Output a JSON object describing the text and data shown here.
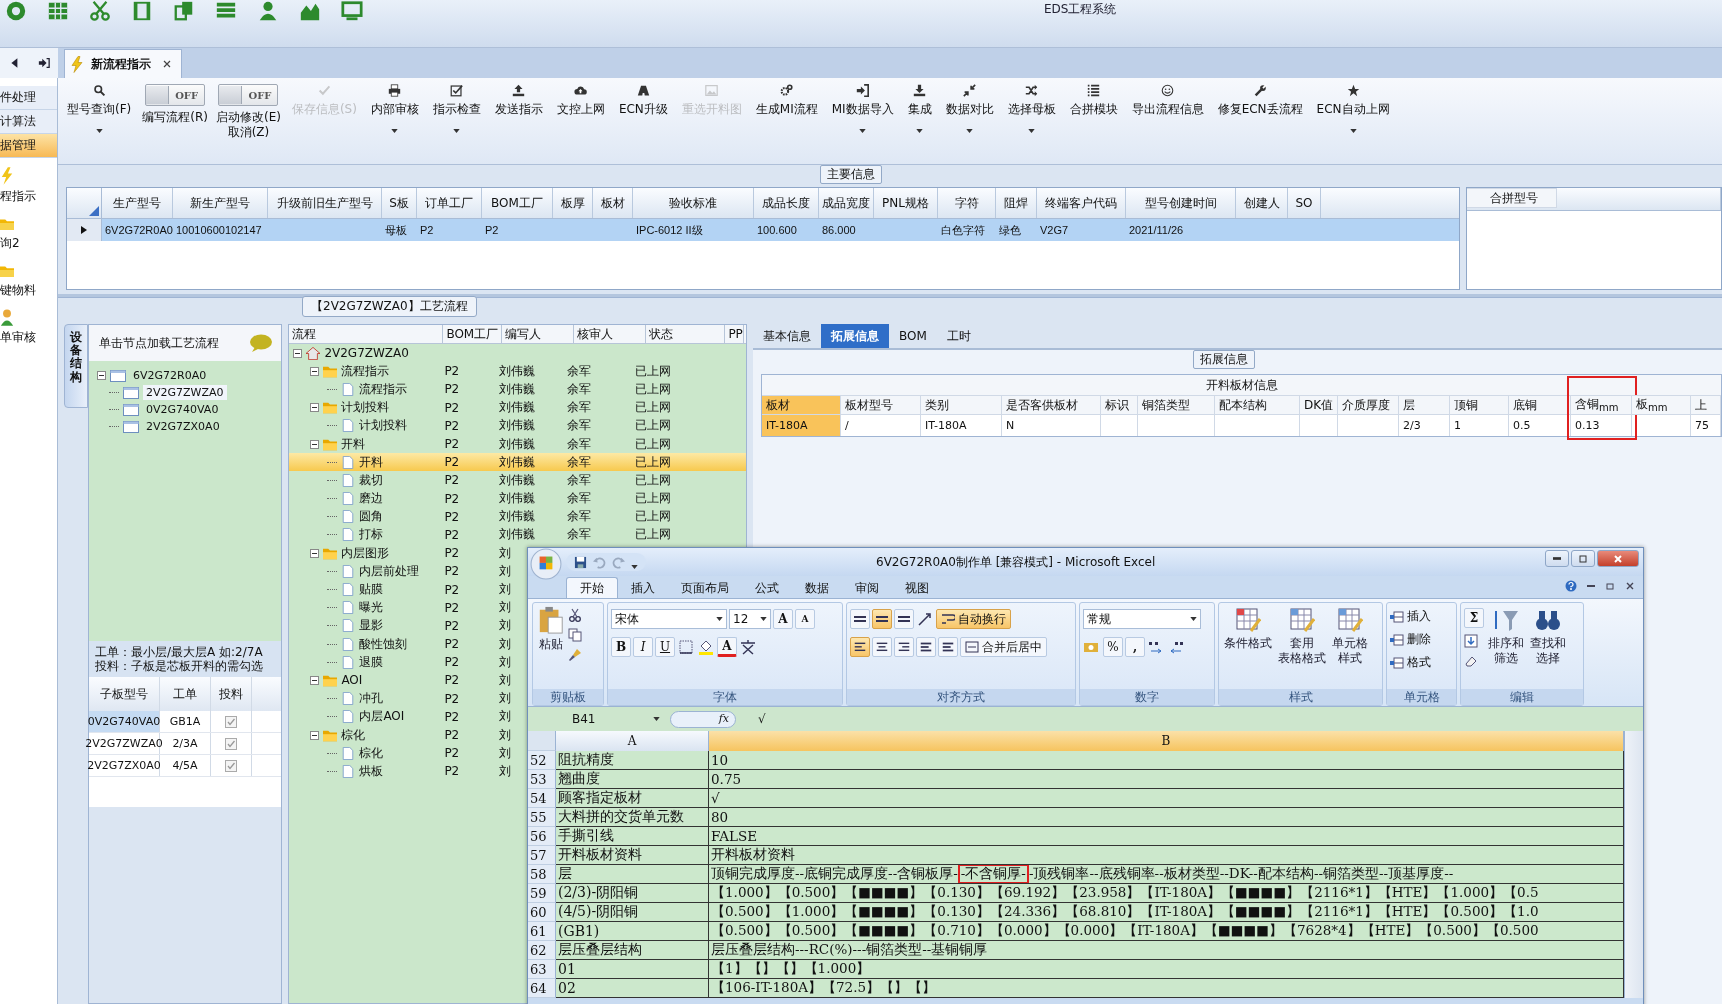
{
  "app_title": "EDS工程系统",
  "nav_items": [
    {
      "label": "件处理",
      "kind": "text",
      "selected": false
    },
    {
      "label": "计算法",
      "kind": "text",
      "selected": false
    },
    {
      "label": "据管理",
      "kind": "text",
      "selected": true
    },
    {
      "label": "程指示",
      "kind": "bolt",
      "selected": false
    },
    {
      "label": "询2",
      "kind": "folder",
      "selected": false
    },
    {
      "label": "键物料",
      "kind": "folder",
      "selected": false
    },
    {
      "label": "单审核",
      "kind": "person",
      "selected": false
    }
  ],
  "tabs": [
    {
      "label": "新流程指示",
      "selected": true
    }
  ],
  "toolbar": [
    {
      "kind": "search",
      "lines": [
        "型号查询(F)"
      ],
      "dropdown": true,
      "disabled": false
    },
    {
      "kind": "toggle",
      "toggle_text": "OFF",
      "on": false,
      "lines": [
        "编写流程(R)"
      ],
      "disabled": false
    },
    {
      "kind": "toggle",
      "toggle_text": "OFF",
      "on": false,
      "lines": [
        "启动修改(E)",
        "取消(Z)"
      ],
      "disabled": false
    },
    {
      "kind": "check",
      "lines": [
        "保存信息(S)"
      ],
      "dropdown": false,
      "disabled": true
    },
    {
      "kind": "print",
      "lines": [
        "内部审核"
      ],
      "dropdown": true,
      "disabled": false
    },
    {
      "kind": "checkbox",
      "lines": [
        "指示检查"
      ],
      "dropdown": true,
      "disabled": false
    },
    {
      "kind": "upload",
      "lines": [
        "发送指示"
      ],
      "dropdown": false,
      "disabled": false
    },
    {
      "kind": "cloud",
      "lines": [
        "文控上网"
      ],
      "dropdown": false,
      "disabled": false
    },
    {
      "kind": "road",
      "lines": [
        "ECN升级"
      ],
      "dropdown": false,
      "disabled": false
    },
    {
      "kind": "picture",
      "lines": [
        "重选开料图"
      ],
      "dropdown": false,
      "disabled": true
    },
    {
      "kind": "gears",
      "lines": [
        "生成MI流程"
      ],
      "dropdown": false,
      "disabled": false
    },
    {
      "kind": "import",
      "lines": [
        "MI数据导入"
      ],
      "dropdown": true,
      "disabled": false
    },
    {
      "kind": "download",
      "lines": [
        "集成"
      ],
      "dropdown": true,
      "disabled": false
    },
    {
      "kind": "compress",
      "lines": [
        "数据对比"
      ],
      "dropdown": true,
      "disabled": false
    },
    {
      "kind": "shuffle",
      "lines": [
        "选择母板"
      ],
      "dropdown": true,
      "disabled": false
    },
    {
      "kind": "list",
      "lines": [
        "合拼模块"
      ],
      "dropdown": false,
      "disabled": false
    },
    {
      "kind": "smile",
      "lines": [
        "导出流程信息"
      ],
      "dropdown": false,
      "disabled": false
    },
    {
      "kind": "wrench",
      "lines": [
        "修复ECN丢流程"
      ],
      "dropdown": false,
      "disabled": false
    },
    {
      "kind": "star",
      "lines": [
        "ECN自动上网"
      ],
      "dropdown": true,
      "disabled": false
    }
  ],
  "main_info": {
    "title": "主要信息",
    "columns": [
      "生产型号",
      "新生产型号",
      "升级前旧生产型号",
      "S板",
      "订单工厂",
      "BOM工厂",
      "板厚",
      "板材",
      "验收标准",
      "成品长度",
      "成品宽度",
      "PNL规格",
      "字符",
      "阻焊",
      "终端客户代码",
      "型号创建时间",
      "创建人",
      "SO"
    ],
    "rows": [
      {
        "selected": true,
        "cells": [
          "6V2G72R0A0",
          "10010600102147",
          "",
          "母板",
          "P2",
          "P2",
          "",
          "",
          "IPC-6012 II级",
          "100.600",
          "86.000",
          "",
          "白色字符",
          "绿色",
          "V2G7",
          "2021/11/26",
          "",
          ""
        ]
      }
    ],
    "merge_columns": [
      "合拼型号"
    ]
  },
  "process_flow": {
    "title": "【2V2G7ZWZA0】工艺流程",
    "side_tab": "设备结构",
    "device_header": "单击节点加载工艺流程",
    "device_tree": [
      {
        "name": "6V2G72R0A0",
        "expanded": true,
        "selected": false,
        "children": [
          {
            "name": "2V2G7ZWZA0",
            "selected": true
          },
          {
            "name": "0V2G740VA0",
            "selected": false
          },
          {
            "name": "2V2G7ZX0A0",
            "selected": false
          }
        ]
      }
    ],
    "note": [
      "工单：最小层/最大层A 如:2/7A",
      "投料：子板是芯板开料的需勾选"
    ],
    "sub_columns": [
      "子板型号",
      "工单",
      "投料"
    ],
    "sub_rows": [
      {
        "model": "0V2G740VA0",
        "order": "GB1A",
        "checked": true,
        "selected": true
      },
      {
        "model": "2V2G7ZWZA0",
        "order": "2/3A",
        "checked": true,
        "selected": false
      },
      {
        "model": "2V2G7ZX0A0",
        "order": "4/5A",
        "checked": true,
        "selected": false
      }
    ],
    "columns": [
      "流程",
      "BOM工厂",
      "编写人",
      "核审人",
      "状态",
      "PP"
    ],
    "tree": [
      {
        "name": "2V2G7ZWZA0",
        "kind": "root",
        "expanded": true,
        "selected": false,
        "children": [
          {
            "name": "流程指示",
            "kind": "folder",
            "expanded": true,
            "selected": false,
            "bom": "P2",
            "writer": "刘伟巍",
            "reviewer": "余军",
            "status": "已上网",
            "children": [
              {
                "name": "流程指示",
                "kind": "file",
                "selected": false,
                "bom": "P2",
                "writer": "刘伟巍",
                "reviewer": "余军",
                "status": "已上网"
              }
            ]
          },
          {
            "name": "计划投料",
            "kind": "folder",
            "expanded": true,
            "selected": false,
            "bom": "P2",
            "writer": "刘伟巍",
            "reviewer": "余军",
            "status": "已上网",
            "children": [
              {
                "name": "计划投料",
                "kind": "file",
                "selected": false,
                "bom": "P2",
                "writer": "刘伟巍",
                "reviewer": "余军",
                "status": "已上网"
              }
            ]
          },
          {
            "name": "开料",
            "kind": "folder",
            "expanded": true,
            "selected": false,
            "bom": "P2",
            "writer": "刘伟巍",
            "reviewer": "余军",
            "status": "已上网",
            "children": [
              {
                "name": "开料",
                "kind": "file",
                "selected": true,
                "bom": "P2",
                "writer": "刘伟巍",
                "reviewer": "余军",
                "status": "已上网"
              },
              {
                "name": "裁切",
                "kind": "file",
                "selected": false,
                "bom": "P2",
                "writer": "刘伟巍",
                "reviewer": "余军",
                "status": "已上网"
              },
              {
                "name": "磨边",
                "kind": "file",
                "selected": false,
                "bom": "P2",
                "writer": "刘伟巍",
                "reviewer": "余军",
                "status": "已上网"
              },
              {
                "name": "圆角",
                "kind": "file",
                "selected": false,
                "bom": "P2",
                "writer": "刘伟巍",
                "reviewer": "余军",
                "status": "已上网"
              },
              {
                "name": "打标",
                "kind": "file",
                "selected": false,
                "bom": "P2",
                "writer": "刘伟巍",
                "reviewer": "余军",
                "status": "已上网"
              }
            ]
          },
          {
            "name": "内层图形",
            "kind": "folder",
            "expanded": true,
            "selected": false,
            "bom": "P2",
            "writer": "刘",
            "children": [
              {
                "name": "内层前处理",
                "kind": "file",
                "selected": false,
                "bom": "P2",
                "writer": "刘"
              },
              {
                "name": "贴膜",
                "kind": "file",
                "selected": false,
                "bom": "P2",
                "writer": "刘"
              },
              {
                "name": "曝光",
                "kind": "file",
                "selected": false,
                "bom": "P2",
                "writer": "刘"
              },
              {
                "name": "显影",
                "kind": "file",
                "selected": false,
                "bom": "P2",
                "writer": "刘"
              },
              {
                "name": "酸性蚀刻",
                "kind": "file",
                "selected": false,
                "bom": "P2",
                "writer": "刘"
              },
              {
                "name": "退膜",
                "kind": "file",
                "selected": false,
                "bom": "P2",
                "writer": "刘"
              }
            ]
          },
          {
            "name": "AOI",
            "kind": "folder",
            "expanded": true,
            "selected": false,
            "bom": "P2",
            "writer": "刘",
            "children": [
              {
                "name": "冲孔",
                "kind": "file",
                "selected": false,
                "bom": "P2",
                "writer": "刘"
              },
              {
                "name": "内层AOI",
                "kind": "file",
                "selected": false,
                "bom": "P2",
                "writer": "刘"
              }
            ]
          },
          {
            "name": "棕化",
            "kind": "folder",
            "expanded": true,
            "selected": false,
            "bom": "P2",
            "writer": "刘",
            "children": [
              {
                "name": "棕化",
                "kind": "file",
                "selected": false,
                "bom": "P2",
                "writer": "刘"
              },
              {
                "name": "烘板",
                "kind": "file",
                "selected": false,
                "bom": "P2",
                "writer": "刘"
              }
            ]
          }
        ]
      }
    ]
  },
  "detail_tabs": [
    {
      "label": "基本信息",
      "selected": false
    },
    {
      "label": "拓展信息",
      "selected": true
    },
    {
      "label": "BOM",
      "selected": false
    },
    {
      "label": "工时",
      "selected": false
    }
  ],
  "detail_group": "拓展信息",
  "material_table": {
    "title": "开料板材信息",
    "columns": [
      {
        "label": "板材",
        "selected": true,
        "boxed": false
      },
      {
        "label": "板材型号",
        "selected": false,
        "boxed": false
      },
      {
        "label": "类别",
        "selected": false,
        "boxed": false
      },
      {
        "label": "是否客供板材",
        "selected": false,
        "boxed": false
      },
      {
        "label": "标识",
        "selected": false,
        "boxed": false
      },
      {
        "label": "铜箔类型",
        "selected": false,
        "boxed": false
      },
      {
        "label": "配本结构",
        "selected": false,
        "boxed": false
      },
      {
        "label": "DK值",
        "selected": false,
        "boxed": false
      },
      {
        "label": "介质厚度",
        "selected": false,
        "boxed": false
      },
      {
        "label": "层",
        "selected": false,
        "boxed": false
      },
      {
        "label": "顶铜",
        "selected": false,
        "boxed": false
      },
      {
        "label": "底铜",
        "selected": false,
        "boxed": false
      },
      {
        "label": "含铜$_{mm}$",
        "selected": false,
        "boxed": true
      },
      {
        "label": "板$_{mm}$",
        "selected": false,
        "boxed": false
      },
      {
        "label": "上",
        "selected": false,
        "boxed": false
      }
    ],
    "rows": [
      [
        "IT-180A",
        "/",
        "IT-180A",
        "N",
        "",
        "",
        "",
        "",
        "",
        "2/3",
        "1",
        "0.5",
        "0.13",
        "",
        "75"
      ]
    ]
  },
  "excel": {
    "title": "6V2G72R0A0制作单  [兼容模式] - Microsoft Excel",
    "tabs": [
      {
        "label": "开始",
        "selected": true
      },
      {
        "label": "插入",
        "selected": false
      },
      {
        "label": "页面布局",
        "selected": false
      },
      {
        "label": "公式",
        "selected": false
      },
      {
        "label": "数据",
        "selected": false
      },
      {
        "label": "审阅",
        "selected": false
      },
      {
        "label": "视图",
        "selected": false
      }
    ],
    "groups": [
      {
        "kind": "clipboard",
        "label": "剪贴板",
        "paste": "粘贴"
      },
      {
        "kind": "font",
        "label": "字体",
        "font": "宋体",
        "size": "12",
        "grow": "A",
        "shrink": "A",
        "color_letter": "A",
        "bold": "B",
        "italic": "I",
        "underline": "U"
      },
      {
        "kind": "alignment",
        "label": "对齐方式",
        "wrap": "自动换行",
        "wrap_on": true,
        "merge": "合并后居中",
        "valign": [
          {
            "selected": false
          },
          {
            "selected": true
          },
          {
            "selected": false
          }
        ],
        "halign": [
          {
            "selected": true
          },
          {
            "selected": false
          },
          {
            "selected": false
          }
        ]
      },
      {
        "kind": "number",
        "label": "数字",
        "format": "常规",
        "percent": "%",
        "comma": ","
      },
      {
        "kind": "styles",
        "label": "样式",
        "buttons": [
          {
            "lines": [
              "条件格式"
            ]
          },
          {
            "lines": [
              "套用",
              "表格格式"
            ]
          },
          {
            "lines": [
              "单元格",
              "样式"
            ]
          }
        ]
      },
      {
        "kind": "cells",
        "label": "单元格",
        "buttons": [
          "插入",
          "删除",
          "格式"
        ]
      },
      {
        "kind": "editing",
        "label": "编辑",
        "sum": "Σ",
        "buttons": [
          {
            "lines": [
              "排序和",
              "筛选"
            ]
          },
          {
            "lines": [
              "查找和",
              "选择"
            ]
          }
        ]
      }
    ],
    "name_box": "B41",
    "fx": "fx",
    "formula": "√",
    "columns": [
      {
        "label": "A",
        "selected": false
      },
      {
        "label": "B",
        "selected": true
      }
    ],
    "rows": [
      {
        "num": "52",
        "a": "阻抗精度",
        "b": "10"
      },
      {
        "num": "53",
        "a": "翘曲度",
        "b": "0.75"
      },
      {
        "num": "54",
        "a": "顾客指定板材",
        "b": "√"
      },
      {
        "num": "55",
        "a": "大料拼的交货单元数",
        "b": "80"
      },
      {
        "num": "56",
        "a": "手撕引线",
        "b": "FALSE"
      },
      {
        "num": "57",
        "a": "开料板材资料",
        "b": "开料板材资料"
      },
      {
        "num": "58",
        "a": "层",
        "b_parts": [
          {
            "text": "顶铜完成厚度--底铜完成厚度--含铜板厚-",
            "boxed": false
          },
          {
            "text": "-不含铜厚-",
            "boxed": true
          },
          {
            "text": "-顶残铜率--底残铜率--板材类型--DK--配本结构--铜箔类型--顶基厚度--",
            "boxed": false
          }
        ]
      },
      {
        "num": "59",
        "a": "(2/3)-阴阳铜",
        "b": "【1.000】【0.500】【■■■■】【0.130】【69.192】【23.958】【IT-180A】【■■■■】【2116*1】【HTE】【1.000】【0.5"
      },
      {
        "num": "60",
        "a": "(4/5)-阴阳铜",
        "b": "【0.500】【1.000】【■■■■】【0.130】【24.336】【68.810】【IT-180A】【■■■■】【2116*1】【HTE】【0.500】【1.0"
      },
      {
        "num": "61",
        "a": "(GB1)",
        "b": "【0.500】【0.500】【■■■■】【0.710】【0.000】【0.000】【IT-180A】【■■■■】【7628*4】【HTE】【0.500】【0.500"
      },
      {
        "num": "62",
        "a": "层压叠层结构",
        "b": "层压叠层结构---RC(%)---铜箔类型--基铜铜厚"
      },
      {
        "num": "63",
        "a": "01",
        "b": "【1】【】【】【1.000】"
      },
      {
        "num": "64",
        "a": "02",
        "b": "【106-IT-180A】【72.5】【】【】"
      }
    ]
  }
}
